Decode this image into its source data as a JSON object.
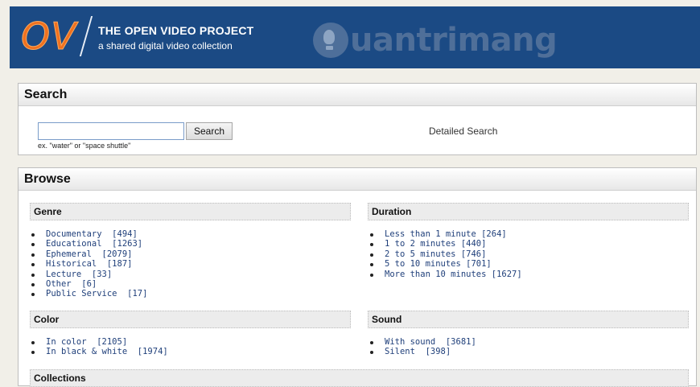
{
  "header": {
    "logo_text": "OV",
    "title": "THE OPEN VIDEO PROJECT",
    "subtitle": "a shared digital video collection",
    "watermark_text": "uantrimang",
    "colors": {
      "background": "#1b4a84",
      "logo": "#f0711f"
    }
  },
  "search": {
    "heading": "Search",
    "input_value": "",
    "button_label": "Search",
    "hint": "ex. \"water\" or \"space shuttle\"",
    "detailed_link": "Detailed Search"
  },
  "browse": {
    "heading": "Browse",
    "genre": {
      "title": "Genre",
      "items": [
        {
          "label": "Documentary  [494]"
        },
        {
          "label": "Educational  [1263]"
        },
        {
          "label": "Ephemeral  [2079]"
        },
        {
          "label": "Historical  [187]"
        },
        {
          "label": "Lecture  [33]"
        },
        {
          "label": "Other  [6]"
        },
        {
          "label": "Public Service  [17]"
        }
      ]
    },
    "duration": {
      "title": "Duration",
      "items": [
        {
          "label": "Less than 1 minute [264]"
        },
        {
          "label": "1 to 2 minutes [440]"
        },
        {
          "label": "2 to 5 minutes [746]"
        },
        {
          "label": "5 to 10 minutes [701]"
        },
        {
          "label": "More than 10 minutes [1627]"
        }
      ]
    },
    "color": {
      "title": "Color",
      "items": [
        {
          "label": "In color  [2105]"
        },
        {
          "label": "In black & white  [1974]"
        }
      ]
    },
    "sound": {
      "title": "Sound",
      "items": [
        {
          "label": "With sound  [3681]"
        },
        {
          "label": "Silent  [398]"
        }
      ]
    },
    "collections": {
      "title": "Collections"
    }
  }
}
